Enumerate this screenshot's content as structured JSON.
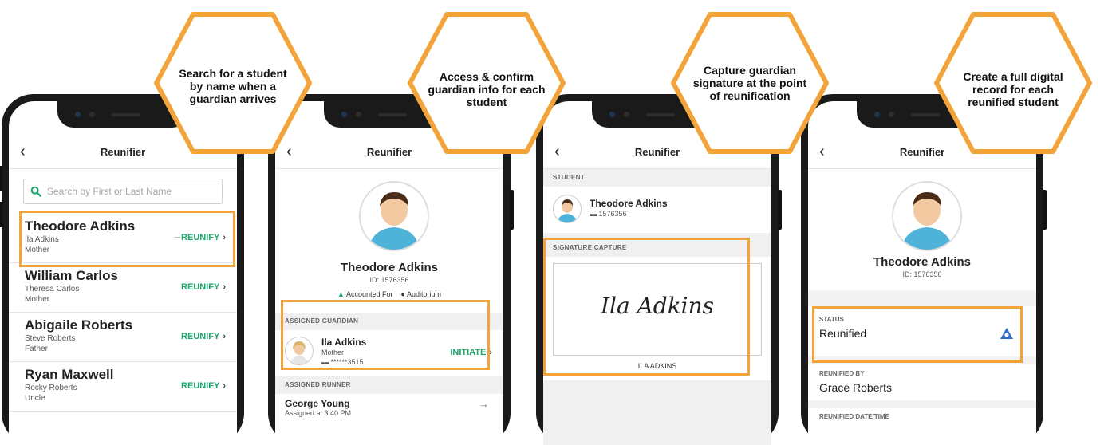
{
  "callouts": [
    {
      "text": "Search for a student by name when a guardian arrives"
    },
    {
      "text": "Access & confirm guardian info for each student"
    },
    {
      "text": "Capture guardian signature at the point of reunification"
    },
    {
      "text": "Create a full digital record for each reunified student"
    }
  ],
  "app_title": "Reunifier",
  "screen1": {
    "search_placeholder": "Search by First or Last Name",
    "students": [
      {
        "name": "Theodore Adkins",
        "guardian": "Ila Adkins",
        "relation": "Mother",
        "action": "REUNIFY"
      },
      {
        "name": "William Carlos",
        "guardian": "Theresa Carlos",
        "relation": "Mother",
        "action": "REUNIFY"
      },
      {
        "name": "Abigaile Roberts",
        "guardian": "Steve Roberts",
        "relation": "Father",
        "action": "REUNIFY"
      },
      {
        "name": "Ryan Maxwell",
        "guardian": "Rocky Roberts",
        "relation": "Uncle",
        "action": "REUNIFY"
      }
    ]
  },
  "screen2": {
    "student_name": "Theodore Adkins",
    "student_id": "ID: 1576356",
    "status": "Accounted For",
    "location": "Auditorium",
    "guardian_header": "ASSIGNED GUARDIAN",
    "guardian_name": "Ila Adkins",
    "guardian_relation": "Mother",
    "guardian_phone": "******3515",
    "guardian_action": "INITIATE",
    "runner_header": "ASSIGNED RUNNER",
    "runner_name": "George Young",
    "runner_time": "Assigned at 3:40 PM"
  },
  "screen3": {
    "student_header": "STUDENT",
    "student_name": "Theodore Adkins",
    "student_id": "1576356",
    "signature_header": "SIGNATURE CAPTURE",
    "signature": "Ila Adkins",
    "signer_name": "ILA ADKINS"
  },
  "screen4": {
    "student_name": "Theodore Adkins",
    "student_id": "ID: 1576356",
    "status_label": "STATUS",
    "status_value": "Reunified",
    "reunified_by_label": "REUNIFIED BY",
    "reunified_by_value": "Grace Roberts",
    "reunified_datetime_label": "REUNIFIED DATE/TIME"
  },
  "colors": {
    "accent_orange": "#f2a33a",
    "reunify_green": "#1aa56a",
    "status_blue": "#2b6cc4"
  }
}
